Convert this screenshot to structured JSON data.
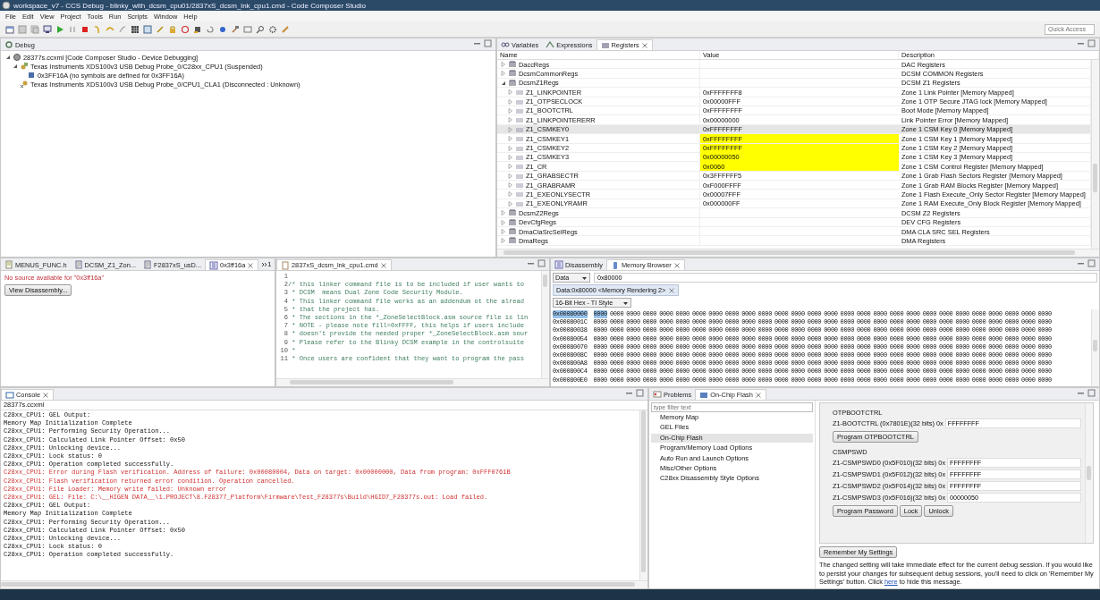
{
  "window": {
    "title": "workspace_v7 - CCS Debug - blinky_with_dcsm_cpu01/2837xS_dcsm_lnk_cpu1.cmd - Code Composer Studio"
  },
  "menu": [
    "File",
    "Edit",
    "View",
    "Project",
    "Tools",
    "Run",
    "Scripts",
    "Window",
    "Help"
  ],
  "quick_access": {
    "placeholder": "Quick Access"
  },
  "debug": {
    "tab": "Debug",
    "tree": [
      {
        "label": "28377s.ccxml [Code Composer Studio - Device Debugging]",
        "kind": "config",
        "expanded": true,
        "children": [
          {
            "label": "Texas Instruments XDS100v3 USB Debug Probe_0/C28xx_CPU1 (Suspended)",
            "kind": "core",
            "expanded": true,
            "children": [
              {
                "label": "0x3FF16A  (no symbols are defined for 0x3FF16A)",
                "kind": "frame"
              }
            ]
          },
          {
            "label": "Texas Instruments XDS100v3 USB Debug Probe_0/CPU1_CLA1 (Disconnected : Unknown)",
            "kind": "disconnected"
          }
        ]
      }
    ]
  },
  "registers": {
    "tabs": [
      {
        "label": "Variables",
        "kind": "variables",
        "selected": false
      },
      {
        "label": "Expressions",
        "kind": "expressions",
        "selected": false
      },
      {
        "label": "Registers",
        "kind": "registers",
        "selected": true
      }
    ],
    "columns": [
      "Name",
      "Value",
      "Description"
    ],
    "rows": [
      {
        "name": "DaccRegs",
        "description": "DAC Registers",
        "expanded": false,
        "selected": false
      },
      {
        "name": "DcsmCommonRegs",
        "description": "DCSM COMMON Registers",
        "expanded": false,
        "selected": false
      },
      {
        "name": "DcsmZ1Regs",
        "description": "DCSM Z1 Registers",
        "expanded": true,
        "selected": false,
        "children": [
          {
            "name": "Z1_LINKPOINTER",
            "value": "0xFFFFFFF8",
            "description": "Zone 1 Link Pointer [Memory Mapped]",
            "changed": false,
            "selected": false
          },
          {
            "name": "Z1_OTPSECLOCK",
            "value": "0x00000FFF",
            "description": "Zone 1 OTP Secure JTAG lock [Memory Mapped]",
            "changed": false,
            "selected": false
          },
          {
            "name": "Z1_BOOTCTRL",
            "value": "0xFFFFFFFF",
            "description": "Boot Mode [Memory Mapped]",
            "changed": false,
            "selected": false
          },
          {
            "name": "Z1_LINKPOINTERERR",
            "value": "0x00000000",
            "description": "Link Pointer Error [Memory Mapped]",
            "changed": false,
            "selected": false
          },
          {
            "name": "Z1_CSMKEY0",
            "value": "0xFFFFFFFF",
            "description": "Zone 1 CSM Key 0 [Memory Mapped]",
            "changed": false,
            "selected": true
          },
          {
            "name": "Z1_CSMKEY1",
            "value": "0xFFFFFFFF",
            "description": "Zone 1 CSM Key 1 [Memory Mapped]",
            "changed": true,
            "selected": false
          },
          {
            "name": "Z1_CSMKEY2",
            "value": "0xFFFFFFFF",
            "description": "Zone 1 CSM Key 2 [Memory Mapped]",
            "changed": true,
            "selected": false
          },
          {
            "name": "Z1_CSMKEY3",
            "value": "0x00000050",
            "description": "Zone 1 CSM Key 3 [Memory Mapped]",
            "changed": true,
            "selected": false
          },
          {
            "name": "Z1_CR",
            "value": "0x0060",
            "description": "Zone 1 CSM Control Register [Memory Mapped]",
            "changed": true,
            "selected": false
          },
          {
            "name": "Z1_GRABSECTR",
            "value": "0x3FFFFFF5",
            "description": "Zone 1 Grab Flash Sectors Register [Memory Mapped]",
            "changed": false,
            "selected": false
          },
          {
            "name": "Z1_GRABRAMR",
            "value": "0xF000FFFF",
            "description": "Zone 1 Grab RAM Blocks Register [Memory Mapped]",
            "changed": false,
            "selected": false
          },
          {
            "name": "Z1_EXEONLYSECTR",
            "value": "0x00007FFF",
            "description": "Zone 1 Flash Execute_Only Sector Register [Memory Mapped]",
            "changed": false,
            "selected": false
          },
          {
            "name": "Z1_EXEONLYRAMR",
            "value": "0x000000FF",
            "description": "Zone 1 RAM Execute_Only Block Register [Memory Mapped]",
            "changed": false,
            "selected": false
          }
        ]
      },
      {
        "name": "DcsmZ2Regs",
        "description": "DCSM Z2 Registers",
        "expanded": false,
        "selected": false
      },
      {
        "name": "DevCfgRegs",
        "description": "DEV CFG Registers",
        "expanded": false,
        "selected": false
      },
      {
        "name": "DmaClaSrcSelRegs",
        "description": "DMA CLA SRC SEL Registers",
        "expanded": false,
        "selected": false
      },
      {
        "name": "DmaRegs",
        "description": "DMA Registers",
        "expanded": false,
        "selected": false
      }
    ]
  },
  "source_editor": {
    "tabs": [
      {
        "label": "MENUS_FUNC.h",
        "kind": "header",
        "selected": false
      },
      {
        "label": "DCSM_Z1_Zon...",
        "kind": "source",
        "selected": false
      },
      {
        "label": "F2837xS_usD...",
        "kind": "source",
        "selected": false
      },
      {
        "label": "0x3ff16a",
        "kind": "disassembly",
        "selected": true
      }
    ],
    "overflow": "1",
    "message": "No source available for \"0x3ff16a\"",
    "button": "View Disassembly..."
  },
  "cmd_editor": {
    "tab": "2837xS_dcsm_lnk_cpu1.cmd",
    "lines": [
      {
        "number": "1"
      },
      {
        "number": "2",
        "text": "/* this linker command file is to be included if user wants to"
      },
      {
        "number": "3",
        "text": " * DCSM  means Dual Zone Code Security Module."
      },
      {
        "number": "4",
        "text": " * This linker command file works as an addendum ot the alread"
      },
      {
        "number": "5",
        "text": " * that the project has."
      },
      {
        "number": "6",
        "text": " * The sections in the *_ZoneSelectBlock.asm source file is lin"
      },
      {
        "number": "7",
        "text": " * NOTE - please note fill=0xFFFF, this helps if users include"
      },
      {
        "number": "8",
        "text": " * doesn't provide the needed proper *_ZoneSelectBlock.asm sour"
      },
      {
        "number": "9",
        "text": " * Please refer to the Blinky DCSM example in the controlsuite"
      },
      {
        "number": "10",
        "text": " *"
      },
      {
        "number": "11",
        "text": " * Once users are confident that they want to program the pass"
      }
    ]
  },
  "memory": {
    "tabs": [
      {
        "label": "Disassembly",
        "kind": "disassembly",
        "selected": false
      },
      {
        "label": "Memory Browser",
        "kind": "memory",
        "selected": true
      }
    ],
    "space": "Data",
    "address": "0x80000",
    "rendering_tab": "Data:0x80000 <Memory Rendering 2>",
    "format": "16-Bit Hex - TI Style",
    "rows": [
      {
        "address": "0x00080000",
        "selected": true,
        "first_word_selected": true,
        "words": [
          "0000",
          "0000",
          "0000",
          "0000",
          "0000",
          "0000",
          "0000",
          "0000",
          "0000",
          "0000",
          "0000",
          "0000",
          "0000",
          "0000",
          "0000",
          "0000",
          "0000",
          "0000",
          "0000",
          "0000",
          "0000",
          "0000",
          "0000",
          "0000",
          "0000",
          "0000",
          "0000",
          "0000"
        ]
      },
      {
        "address": "0x0008001C",
        "selected": false,
        "first_word_selected": false,
        "words": [
          "0000",
          "0000",
          "0000",
          "0000",
          "0000",
          "0000",
          "0000",
          "0000",
          "0000",
          "0000",
          "0000",
          "0000",
          "0000",
          "0000",
          "0000",
          "0000",
          "0000",
          "0000",
          "0000",
          "0000",
          "0000",
          "0000",
          "0000",
          "0000",
          "0000",
          "0000",
          "0000",
          "0000"
        ]
      },
      {
        "address": "0x00080038",
        "selected": false,
        "first_word_selected": false,
        "words": [
          "0000",
          "0000",
          "0000",
          "0000",
          "0000",
          "0000",
          "0000",
          "0000",
          "0000",
          "0000",
          "0000",
          "0000",
          "0000",
          "0000",
          "0000",
          "0000",
          "0000",
          "0000",
          "0000",
          "0000",
          "0000",
          "0000",
          "0000",
          "0000",
          "0000",
          "0000",
          "0000",
          "0000"
        ]
      },
      {
        "address": "0x00080054",
        "selected": false,
        "first_word_selected": false,
        "words": [
          "0000",
          "0000",
          "0000",
          "0000",
          "0000",
          "0000",
          "0000",
          "0000",
          "0000",
          "0000",
          "0000",
          "0000",
          "0000",
          "0000",
          "0000",
          "0000",
          "0000",
          "0000",
          "0000",
          "0000",
          "0000",
          "0000",
          "0000",
          "0000",
          "0000",
          "0000",
          "0000",
          "0000"
        ]
      },
      {
        "address": "0x00080070",
        "selected": false,
        "first_word_selected": false,
        "words": [
          "0000",
          "0000",
          "0000",
          "0000",
          "0000",
          "0000",
          "0000",
          "0000",
          "0000",
          "0000",
          "0000",
          "0000",
          "0000",
          "0000",
          "0000",
          "0000",
          "0000",
          "0000",
          "0000",
          "0000",
          "0000",
          "0000",
          "0000",
          "0000",
          "0000",
          "0000",
          "0000",
          "0000"
        ]
      },
      {
        "address": "0x0008008C",
        "selected": false,
        "first_word_selected": false,
        "words": [
          "0000",
          "0000",
          "0000",
          "0000",
          "0000",
          "0000",
          "0000",
          "0000",
          "0000",
          "0000",
          "0000",
          "0000",
          "0000",
          "0000",
          "0000",
          "0000",
          "0000",
          "0000",
          "0000",
          "0000",
          "0000",
          "0000",
          "0000",
          "0000",
          "0000",
          "0000",
          "0000",
          "0000"
        ]
      },
      {
        "address": "0x000800A8",
        "selected": false,
        "first_word_selected": false,
        "words": [
          "0000",
          "0000",
          "0000",
          "0000",
          "0000",
          "0000",
          "0000",
          "0000",
          "0000",
          "0000",
          "0000",
          "0000",
          "0000",
          "0000",
          "0000",
          "0000",
          "0000",
          "0000",
          "0000",
          "0000",
          "0000",
          "0000",
          "0000",
          "0000",
          "0000",
          "0000",
          "0000",
          "0000"
        ]
      },
      {
        "address": "0x000800C4",
        "selected": false,
        "first_word_selected": false,
        "words": [
          "0000",
          "0000",
          "0000",
          "0000",
          "0000",
          "0000",
          "0000",
          "0000",
          "0000",
          "0000",
          "0000",
          "0000",
          "0000",
          "0000",
          "0000",
          "0000",
          "0000",
          "0000",
          "0000",
          "0000",
          "0000",
          "0000",
          "0000",
          "0000",
          "0000",
          "0000",
          "0000",
          "0000"
        ]
      },
      {
        "address": "0x000800E0",
        "selected": false,
        "first_word_selected": false,
        "words": [
          "0000",
          "0000",
          "0000",
          "0000",
          "0000",
          "0000",
          "0000",
          "0000",
          "0000",
          "0000",
          "0000",
          "0000",
          "0000",
          "0000",
          "0000",
          "0000",
          "0000",
          "0000",
          "0000",
          "0000",
          "0000",
          "0000",
          "0000",
          "0000",
          "0000",
          "0000",
          "0000",
          "0000"
        ]
      }
    ]
  },
  "console": {
    "tab": "Console",
    "session": "28377s.ccxml",
    "lines": [
      {
        "text": "C28xx_CPU1: GEL Output:",
        "kind": "info"
      },
      {
        "text": "Memory Map Initialization Complete",
        "kind": "info"
      },
      {
        "text": "C28xx_CPU1: Performing Security Operation...",
        "kind": "info"
      },
      {
        "text": "C28xx_CPU1: Calculated Link Pointer Offset: 0x50",
        "kind": "info"
      },
      {
        "text": "C28xx_CPU1: Unlocking device...",
        "kind": "info"
      },
      {
        "text": "C28xx_CPU1: Lock status: 0",
        "kind": "info"
      },
      {
        "text": "C28xx_CPU1: Operation completed successfully.",
        "kind": "info"
      },
      {
        "text": "C28xx_CPU1: Error during Flash verification. Address of failure: 0x00080004, Data on target: 0x00000000, Data from program: 0xFFF0761B",
        "kind": "error"
      },
      {
        "text": "C28xx_CPU1: Flash verification returned error condition. Operation cancelled.",
        "kind": "error"
      },
      {
        "text": "C28xx_CPU1: File Loader: Memory write failed: Unknown error",
        "kind": "error"
      },
      {
        "text": "C28xx_CPU1: GEL: File: C:\\__HIGEN DATA__\\1.PROJECT\\8.F28377_Platform\\Firmware\\Test_F28377s\\Build\\HGID7_F28377s.out: Load failed.",
        "kind": "error"
      },
      {
        "text": "C28xx_CPU1: GEL Output:",
        "kind": "info"
      },
      {
        "text": "Memory Map Initialization Complete",
        "kind": "info"
      },
      {
        "text": "C28xx_CPU1: Performing Security Operation...",
        "kind": "info"
      },
      {
        "text": "C28xx_CPU1: Calculated Link Pointer Offset: 0x50",
        "kind": "info"
      },
      {
        "text": "C28xx_CPU1: Unlocking device...",
        "kind": "info"
      },
      {
        "text": "C28xx_CPU1: Lock status: 0",
        "kind": "info"
      },
      {
        "text": "C28xx_CPU1: Operation completed successfully.",
        "kind": "info"
      }
    ]
  },
  "flash": {
    "tabs": [
      {
        "label": "Problems",
        "kind": "problems",
        "selected": false
      },
      {
        "label": "On-Chip Flash",
        "kind": "flash",
        "selected": true
      }
    ],
    "filter": {
      "placeholder": "type filter text"
    },
    "categories": [
      {
        "label": "Memory Map",
        "selected": false
      },
      {
        "label": "GEL Files",
        "selected": false
      },
      {
        "label": "On-Chip Flash",
        "selected": true
      },
      {
        "label": "Program/Memory Load Options",
        "selected": false
      },
      {
        "label": "Auto Run and Launch Options",
        "selected": false
      },
      {
        "label": "Misc/Other Options",
        "selected": false
      },
      {
        "label": "C28xx Disassembly Style Options",
        "selected": false
      }
    ],
    "sections": [
      {
        "title": "OTPBOOTCTRL",
        "fields": [
          {
            "label": "Z1-BOOTCTRL (0x7801E)(32 bits) 0x",
            "value": "FFFFFFFF"
          }
        ],
        "buttons": [
          "Program OTPBOOTCTRL"
        ]
      },
      {
        "title": "CSMPSWD",
        "fields": [
          {
            "label": "Z1-CSMPSWD0 (0x5F010)(32 bits) 0x",
            "value": "FFFFFFFF"
          },
          {
            "label": "Z1-CSMPSWD1 (0x5F012)(32 bits) 0x",
            "value": "FFFFFFFF"
          },
          {
            "label": "Z1-CSMPSWD2 (0x5F014)(32 bits) 0x",
            "value": "FFFFFFFF"
          },
          {
            "label": "Z1-CSMPSWD3 (0x5F016)(32 bits) 0x",
            "value": "00000050"
          }
        ],
        "buttons": [
          "Program Password",
          "Lock",
          "Unlock"
        ]
      }
    ],
    "remember_button": "Remember My Settings",
    "message": {
      "before": "The changed setting will take immediate effect for the current debug session.  If you would like to persist your changes for subsequent debug sessions, you'll need to click on 'Remember My Settings' button. Click ",
      "link": "here",
      "after": " to hide this message."
    }
  }
}
